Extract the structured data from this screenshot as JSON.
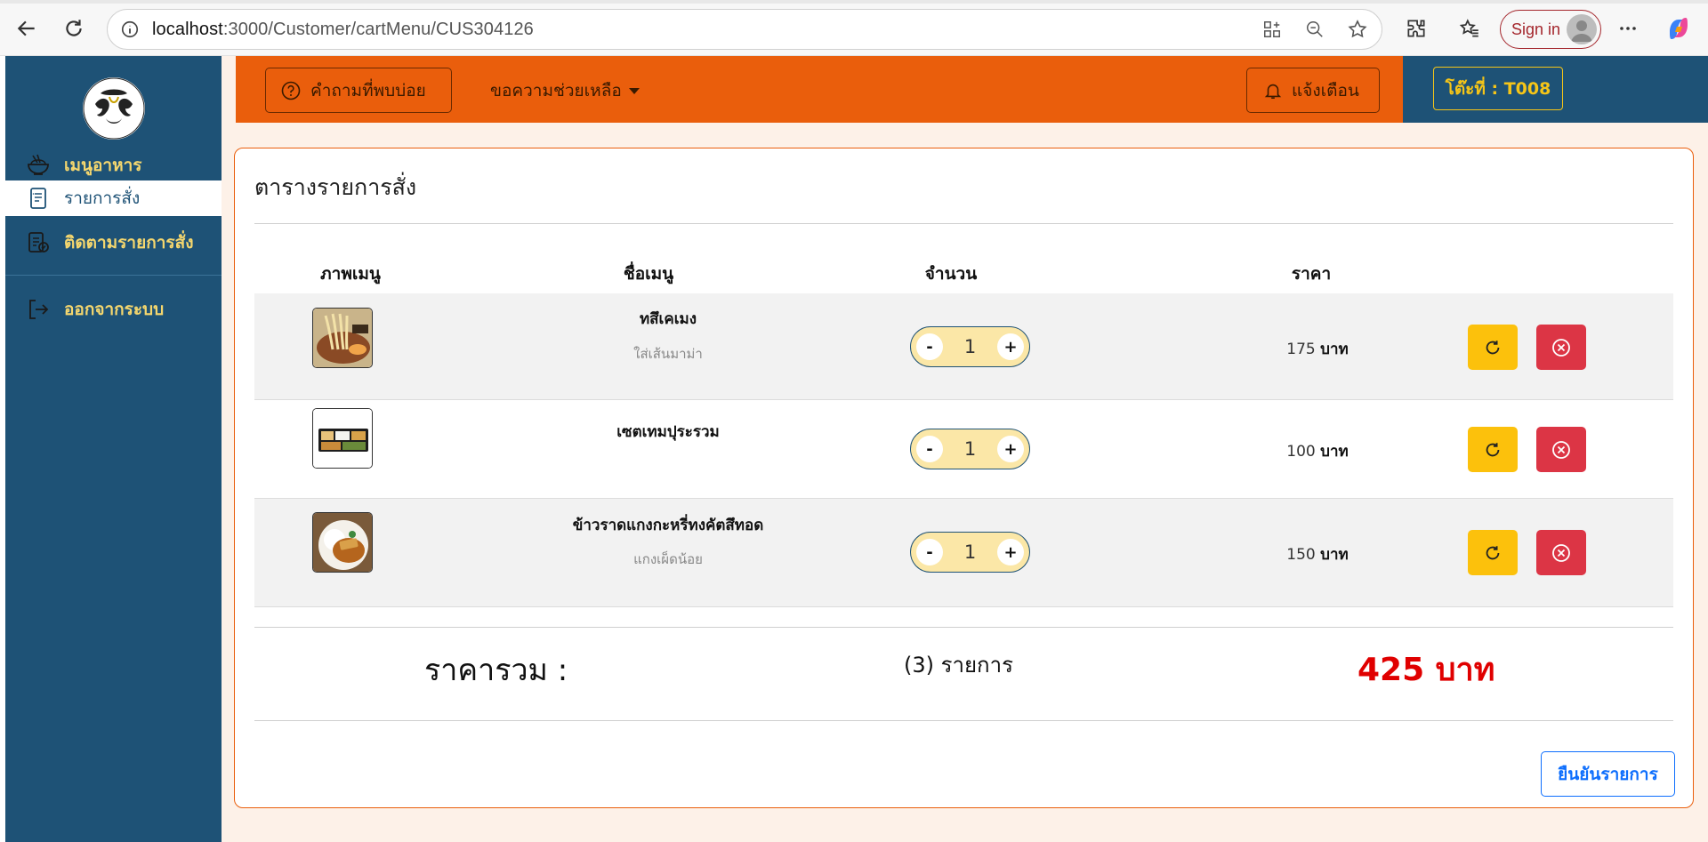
{
  "browser": {
    "url_host": "localhost",
    "url_path": ":3000/Customer/cartMenu/CUS304126",
    "signin_label": "Sign in"
  },
  "sidebar": {
    "items": [
      {
        "label": "เมนูอาหาร",
        "icon": "bowl-icon",
        "active": false
      },
      {
        "label": "รายการสั่ง",
        "icon": "receipt-list-icon",
        "active": true
      },
      {
        "label": "ติดตามรายการสั่ง",
        "icon": "order-tracking-icon",
        "active": false
      },
      {
        "label": "ออกจากระบบ",
        "icon": "logout-icon",
        "active": false
      }
    ]
  },
  "topbar": {
    "faq_label": "คำถามที่พบบ่อย",
    "help_label": "ขอความช่วยเหลือ",
    "notify_label": "แจ้งเตือน",
    "table_badge": "โต๊ะที่ : T008"
  },
  "cart": {
    "title": "ตารางรายการสั่ง",
    "headers": {
      "image": "ภาพเมนู",
      "name": "ชื่อเมนู",
      "quantity": "จำนวน",
      "price": "ราคา"
    },
    "items": [
      {
        "name": "ทสึเคเมง",
        "note": "ใส่เส้นมาม่า",
        "qty": "1",
        "price": "175",
        "unit": "บาท",
        "image": "ramen-photo"
      },
      {
        "name": "เซตเทมปุระรวม",
        "note": "",
        "qty": "1",
        "price": "100",
        "unit": "บาท",
        "image": "tempura-set-photo"
      },
      {
        "name": "ข้าวราดแกงกะหรี่ทงคัตสึทอด",
        "note": "แกงเผ็ดน้อย",
        "qty": "1",
        "price": "150",
        "unit": "บาท",
        "image": "curry-katsu-photo"
      }
    ],
    "minus_label": "-",
    "plus_label": "+",
    "summary": {
      "label": "ราคารวม :",
      "count": "(3) รายการ",
      "total": "425 บาท"
    },
    "confirm_label": "ยืนยันรายการ"
  },
  "colors": {
    "sidebar": "#1e5276",
    "topbar": "#ea5e0c",
    "accent_yellow": "#f5d76e",
    "refresh_button": "#fcc10c",
    "delete_button": "#dc3545",
    "total_red": "#e00000",
    "confirm_blue": "#0d6efd"
  }
}
